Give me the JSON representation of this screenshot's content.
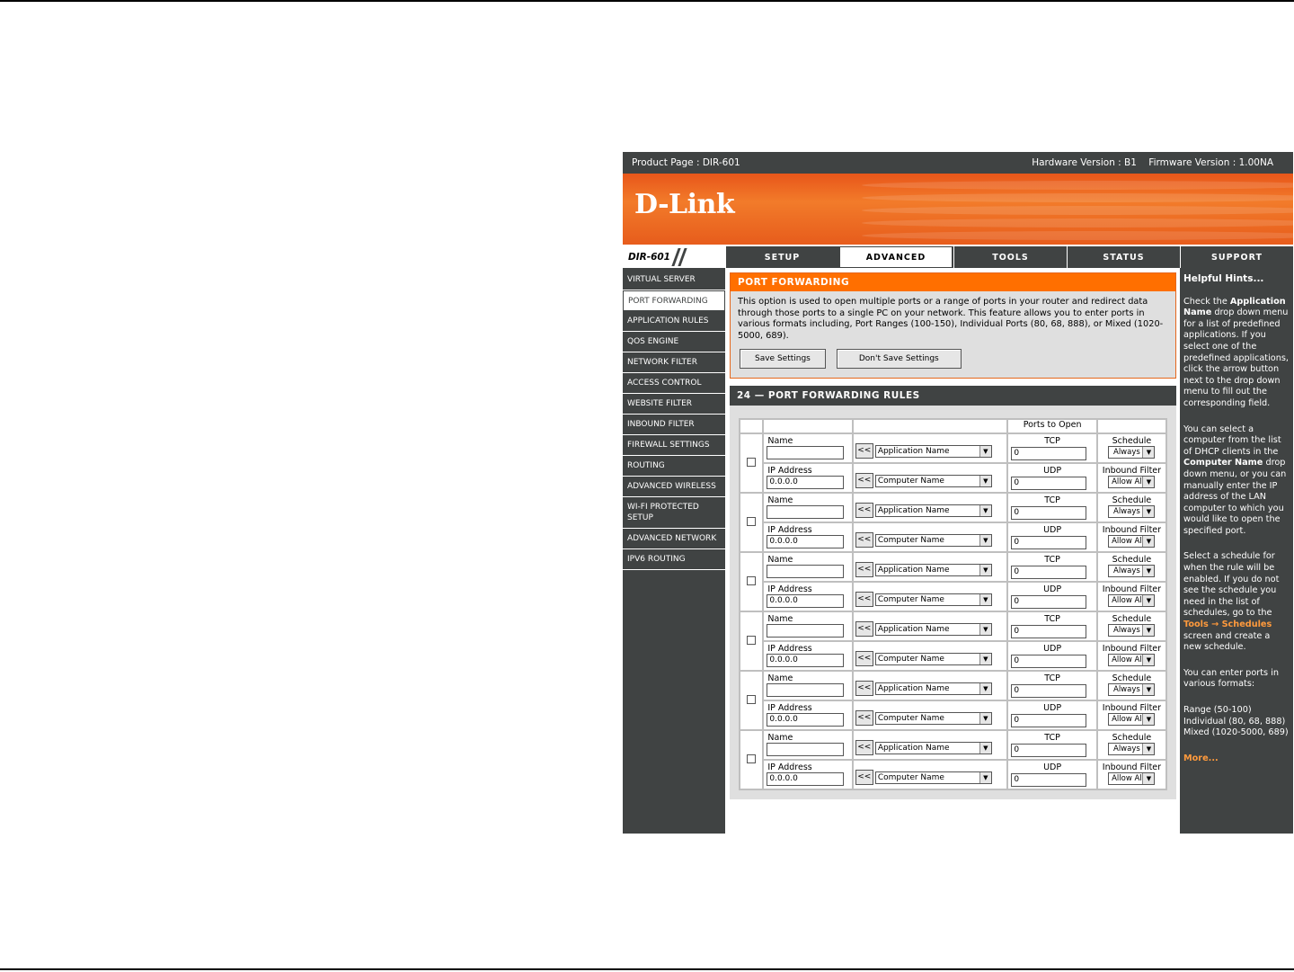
{
  "topbar": {
    "product": "Product Page : DIR-601",
    "hardware": "Hardware Version : B1",
    "firmware": "Firmware Version : 1.00NA"
  },
  "brand": {
    "logo": "D-Link",
    "model": "DIR-601"
  },
  "tabs": [
    {
      "label": "SETUP",
      "active": false
    },
    {
      "label": "ADVANCED",
      "active": true
    },
    {
      "label": "TOOLS",
      "active": false
    },
    {
      "label": "STATUS",
      "active": false
    },
    {
      "label": "SUPPORT",
      "active": false
    }
  ],
  "sidebar": [
    {
      "label": "VIRTUAL SERVER"
    },
    {
      "label": "PORT FORWARDING"
    },
    {
      "label": "APPLICATION RULES"
    },
    {
      "label": "QOS ENGINE"
    },
    {
      "label": "NETWORK FILTER"
    },
    {
      "label": "ACCESS CONTROL"
    },
    {
      "label": "WEBSITE FILTER"
    },
    {
      "label": "INBOUND FILTER"
    },
    {
      "label": "FIREWALL SETTINGS"
    },
    {
      "label": "ROUTING"
    },
    {
      "label": "ADVANCED WIRELESS"
    },
    {
      "label": "WI-FI PROTECTED SETUP"
    },
    {
      "label": "ADVANCED NETWORK"
    },
    {
      "label": "IPV6 ROUTING"
    }
  ],
  "port_forwarding": {
    "title": "PORT FORWARDING",
    "description": "This option is used to open multiple ports or a range of ports in your router and redirect data through those ports to a single PC on your network. This feature allows you to enter ports in various formats including, Port Ranges (100-150), Individual Ports (80, 68, 888), or Mixed (1020-5000, 689).",
    "save_label": "Save Settings",
    "dont_save_label": "Don't Save Settings"
  },
  "rules": {
    "title": "24 — PORT FORWARDING RULES",
    "ports_header": "Ports to Open",
    "name_label": "Name",
    "ip_label": "IP Address",
    "tcp_label": "TCP",
    "udp_label": "UDP",
    "schedule_label": "Schedule",
    "inbound_label": "Inbound Filter",
    "arrow_label": "<<",
    "app_placeholder": "Application Name",
    "computer_placeholder": "Computer Name",
    "schedule_value": "Always",
    "inbound_value": "Allow Al",
    "rows": [
      {
        "name": "",
        "ip": "0.0.0.0",
        "tcp": "0",
        "udp": "0"
      },
      {
        "name": "",
        "ip": "0.0.0.0",
        "tcp": "0",
        "udp": "0"
      },
      {
        "name": "",
        "ip": "0.0.0.0",
        "tcp": "0",
        "udp": "0"
      },
      {
        "name": "",
        "ip": "0.0.0.0",
        "tcp": "0",
        "udp": "0"
      },
      {
        "name": "",
        "ip": "0.0.0.0",
        "tcp": "0",
        "udp": "0"
      },
      {
        "name": "",
        "ip": "0.0.0.0",
        "tcp": "0",
        "udp": "0"
      }
    ]
  },
  "hints": {
    "title": "Helpful Hints...",
    "p1_a": "Check the ",
    "p1_b": "Application Name",
    "p1_c": " drop down menu for a list of predefined applications. If you select one of the predefined applications, click the arrow button next to the drop down menu to fill out the corresponding field.",
    "p2_a": "You can select a computer from the list of DHCP clients in the ",
    "p2_b": "Computer Name",
    "p2_c": " drop down menu, or you can manually enter the IP address of the LAN computer to which you would like to open the specified port.",
    "p3_a": "Select a schedule for when the rule will be enabled. If you do not see the schedule you need in the list of schedules, go to the ",
    "p3_link": "Tools → Schedules",
    "p3_c": " screen and create a new schedule.",
    "p4": "You can enter ports in various formats:",
    "p5_1": "Range (50-100)",
    "p5_2": "Individual (80, 68, 888)",
    "p5_3": "Mixed (1020-5000, 689)",
    "more": "More..."
  }
}
